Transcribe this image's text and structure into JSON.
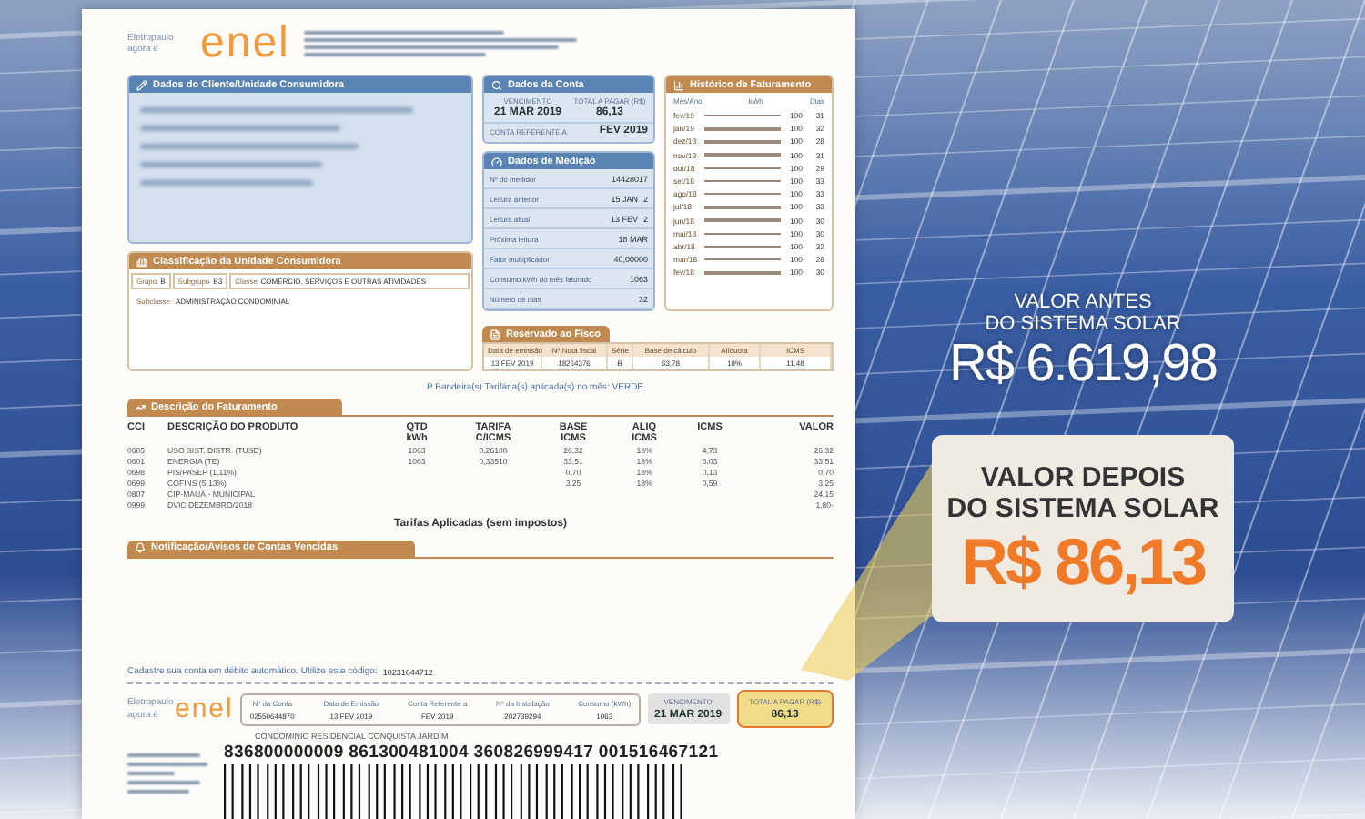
{
  "bill": {
    "header": {
      "caption": "Eletropaulo agora é",
      "logo": "enel"
    },
    "client": {
      "title": "Dados do Cliente/Unidade Consumidora"
    },
    "classification": {
      "title": "Classificação da Unidade Consumidora",
      "fields": [
        {
          "label": "Grupo",
          "value": "B"
        },
        {
          "label": "Subgrupo",
          "value": "B3"
        },
        {
          "label": "Classe",
          "value": "COMÉRCIO, SERVIÇOS E OUTRAS ATIVIDADES"
        }
      ],
      "subclass": {
        "label": "Subclasse",
        "value": "ADMINISTRAÇÃO CONDOMINIAL"
      }
    },
    "account": {
      "title": "Dados da Conta",
      "due_label": "VENCIMENTO",
      "due": "21 MAR 2019",
      "total_label": "TOTAL A PAGAR (R$)",
      "total": "86,13",
      "ref_label": "CONTA REFERENTE A",
      "ref": "FEV 2019"
    },
    "measurement": {
      "title": "Dados de Medição",
      "rows": [
        {
          "label": "Nº do medidor",
          "value": "14428017"
        },
        {
          "label": "Leitura anterior",
          "date": "15 JAN",
          "value": "2"
        },
        {
          "label": "Leitura atual",
          "date": "13 FEV",
          "value": "2"
        },
        {
          "label": "Próxima leitura",
          "value": "18 MAR"
        },
        {
          "label": "Fator multiplicador",
          "value": "40,00000"
        },
        {
          "label": "Consumo kWh do mês faturado",
          "value": "1063"
        },
        {
          "label": "Número de dias",
          "value": "32"
        }
      ]
    },
    "history": {
      "title": "Histórico de Faturamento",
      "columns": [
        "Mês/Ano",
        "kWh",
        "Dias"
      ],
      "rows": [
        {
          "month": "fev/19",
          "kwh": "100",
          "days": "31"
        },
        {
          "month": "jan/19",
          "kwh": "100",
          "days": "32"
        },
        {
          "month": "dez/18",
          "kwh": "100",
          "days": "28"
        },
        {
          "month": "nov/18",
          "kwh": "100",
          "days": "31"
        },
        {
          "month": "out/18",
          "kwh": "100",
          "days": "29"
        },
        {
          "month": "set/18",
          "kwh": "100",
          "days": "33"
        },
        {
          "month": "ago/18",
          "kwh": "100",
          "days": "33"
        },
        {
          "month": "jul/18",
          "kwh": "100",
          "days": "33"
        },
        {
          "month": "jun/18",
          "kwh": "100",
          "days": "30"
        },
        {
          "month": "mai/18",
          "kwh": "100",
          "days": "30"
        },
        {
          "month": "abr/18",
          "kwh": "100",
          "days": "32"
        },
        {
          "month": "mar/18",
          "kwh": "100",
          "days": "28"
        },
        {
          "month": "fev/18",
          "kwh": "100",
          "days": "30"
        }
      ]
    },
    "fiscal": {
      "title": "Reservado ao Fisco",
      "columns": [
        "Data de emissão",
        "Nº Nota fiscal",
        "Série",
        "Base de cálculo",
        "Alíquota",
        "ICMS"
      ],
      "row": [
        "13 FEV 2019",
        "18264376",
        "B",
        "63,78",
        "18%",
        "11,48"
      ]
    },
    "flag_notice": "P Bandeira(s) Tarifária(s) aplicada(s) no mês: VERDE",
    "billing": {
      "title": "Descrição do Faturamento",
      "header_rows": [
        [
          "CCI",
          "DESCRIÇÃO DO PRODUTO",
          "QTD",
          "TARIFA",
          "BASE",
          "ALIQ",
          "ICMS",
          "VALOR"
        ],
        [
          null,
          null,
          "kWh",
          "C/ICMS",
          "ICMS",
          "ICMS",
          null,
          null
        ]
      ],
      "rows": [
        [
          "0605",
          "USO SIST. DISTR. (TUSD)",
          "1063",
          "0,26100",
          "26,32",
          "18%",
          "4,73",
          "26,32"
        ],
        [
          "0601",
          "ENERGIA (TE)",
          "1063",
          "0,33510",
          "33,51",
          "18%",
          "6,03",
          "33,51"
        ],
        [
          "0698",
          "PIS/PASEP (1,11%)",
          null,
          null,
          "0,70",
          "18%",
          "0,13",
          "0,70"
        ],
        [
          "0699",
          "COFINS (5,13%)",
          null,
          null,
          "3,25",
          "18%",
          "0,59",
          "3,25"
        ],
        [
          "0807",
          "CIP-MAUÁ - MUNICIPAL",
          null,
          null,
          null,
          null,
          null,
          "24,15"
        ],
        [
          "0999",
          "DVIC DEZEMBRO/2018",
          null,
          null,
          null,
          null,
          null,
          "1,80-"
        ]
      ],
      "footer": "Tarifas Aplicadas (sem impostos)"
    },
    "notices": {
      "title": "Notificação/Avisos de Contas Vencidas"
    },
    "autodebit": {
      "text": "Cadastre sua conta em débito automático. Utilize este código:",
      "code": "10231644712"
    },
    "stub": {
      "caption": "Eletropaulo agora é",
      "logo": "enel",
      "fields": [
        {
          "label": "Nº da Conta",
          "value": "02550644870"
        },
        {
          "label": "Data de Emissão",
          "value": "13 FEV 2019"
        },
        {
          "label": "Conta Referente a",
          "value": "FEV 2019"
        },
        {
          "label": "Nº da Instalação",
          "value": "202739294"
        },
        {
          "label": "Consumo (kWh)",
          "value": "1063"
        }
      ],
      "due": {
        "label": "VENCIMENTO",
        "value": "21 MAR 2019"
      },
      "total": {
        "label": "TOTAL A PAGAR (R$)",
        "value": "86,13",
        "highlighted": true
      },
      "customer": "CONDOMINIO RESIDENCIAL CONQUISTA JARDIM",
      "barcode_number": "836800000009 861300481004 360826999417 001516467121"
    }
  },
  "before": {
    "label_lines": [
      "VALOR ANTES",
      "DO SISTEMA SOLAR"
    ],
    "value": "R$ 6.619,98"
  },
  "after": {
    "label_lines": [
      "VALOR DEPOIS",
      "DO SISTEMA SOLAR"
    ],
    "value": "R$ 86,13"
  }
}
